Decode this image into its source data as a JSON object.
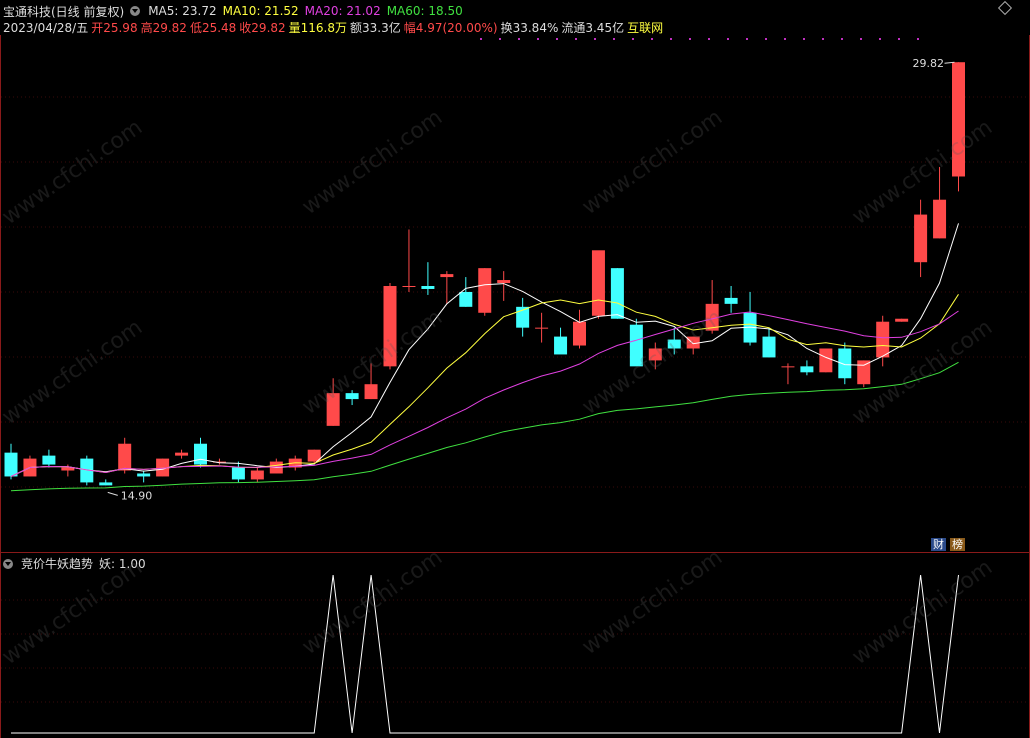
{
  "header": {
    "stock_name": "宝通科技(日线 前复权)",
    "ma5": "MA5: 23.72",
    "ma10": "MA10: 21.52",
    "ma20": "MA20: 21.02",
    "ma60": "MA60: 18.50"
  },
  "quote_bar": {
    "date": "2023/04/28/五",
    "open": "开25.98",
    "high": "高29.82",
    "low": "低25.48",
    "close": "收29.82",
    "volume": "量116.8万",
    "amount": "额33.3亿",
    "change": "幅4.97(20.00%)",
    "turnover": "换33.84%",
    "float": "流通3.45亿",
    "source": "互联网"
  },
  "chart_annotations": {
    "max_price": "29.82",
    "min_price": "14.90"
  },
  "tags": {
    "cai": "财",
    "bang": "榜"
  },
  "indicator": {
    "title": "竞价牛妖趋势",
    "value": "妖: 1.00"
  },
  "watermark": "www.cfchi.com",
  "colors": {
    "up": "#ff4a4a",
    "down": "#40ffff",
    "ma5": "#ffffff",
    "ma10": "#ffff40",
    "ma20": "#e040e0",
    "ma60": "#40e040",
    "header_ma5": "#dddddd",
    "header_ma10": "#ffff40",
    "header_ma20": "#e040e0",
    "header_ma60": "#40e040"
  },
  "chart_data": {
    "type": "candlestick",
    "ylim": [
      14.0,
      30.6
    ],
    "candles": [
      {
        "o": 16.7,
        "h": 17.0,
        "l": 15.8,
        "c": 15.9
      },
      {
        "o": 15.9,
        "h": 16.6,
        "l": 15.9,
        "c": 16.5
      },
      {
        "o": 16.6,
        "h": 16.8,
        "l": 16.2,
        "c": 16.3
      },
      {
        "o": 16.1,
        "h": 16.3,
        "l": 15.9,
        "c": 16.2
      },
      {
        "o": 16.5,
        "h": 16.6,
        "l": 15.6,
        "c": 15.7
      },
      {
        "o": 15.7,
        "h": 15.8,
        "l": 15.6,
        "c": 15.6
      },
      {
        "o": 16.1,
        "h": 17.2,
        "l": 16.0,
        "c": 17.0
      },
      {
        "o": 16.0,
        "h": 16.1,
        "l": 15.7,
        "c": 15.9
      },
      {
        "o": 15.9,
        "h": 16.5,
        "l": 15.9,
        "c": 16.5
      },
      {
        "o": 16.6,
        "h": 16.8,
        "l": 16.5,
        "c": 16.7
      },
      {
        "o": 17.0,
        "h": 17.2,
        "l": 16.2,
        "c": 16.3
      },
      {
        "o": 16.4,
        "h": 16.5,
        "l": 16.3,
        "c": 16.4
      },
      {
        "o": 16.2,
        "h": 16.4,
        "l": 15.7,
        "c": 15.8
      },
      {
        "o": 15.8,
        "h": 16.2,
        "l": 15.7,
        "c": 16.1
      },
      {
        "o": 16.0,
        "h": 16.5,
        "l": 16.0,
        "c": 16.4
      },
      {
        "o": 16.2,
        "h": 16.6,
        "l": 16.1,
        "c": 16.5
      },
      {
        "o": 16.4,
        "h": 16.8,
        "l": 16.3,
        "c": 16.8
      },
      {
        "o": 17.6,
        "h": 19.2,
        "l": 17.6,
        "c": 18.7
      },
      {
        "o": 18.7,
        "h": 18.8,
        "l": 18.3,
        "c": 18.5
      },
      {
        "o": 18.5,
        "h": 19.7,
        "l": 18.5,
        "c": 19.0
      },
      {
        "o": 19.6,
        "h": 22.4,
        "l": 19.5,
        "c": 22.3
      },
      {
        "o": 22.3,
        "h": 24.2,
        "l": 22.1,
        "c": 22.3
      },
      {
        "o": 22.3,
        "h": 23.1,
        "l": 22.0,
        "c": 22.2
      },
      {
        "o": 22.6,
        "h": 22.8,
        "l": 21.7,
        "c": 22.7
      },
      {
        "o": 22.1,
        "h": 22.6,
        "l": 21.6,
        "c": 21.6
      },
      {
        "o": 21.4,
        "h": 22.9,
        "l": 21.3,
        "c": 22.9
      },
      {
        "o": 22.4,
        "h": 22.8,
        "l": 21.8,
        "c": 22.5
      },
      {
        "o": 21.6,
        "h": 21.9,
        "l": 20.6,
        "c": 20.9
      },
      {
        "o": 20.9,
        "h": 21.4,
        "l": 20.4,
        "c": 20.9
      },
      {
        "o": 20.6,
        "h": 20.9,
        "l": 20.1,
        "c": 20.0
      },
      {
        "o": 20.3,
        "h": 21.5,
        "l": 20.2,
        "c": 21.1
      },
      {
        "o": 21.3,
        "h": 23.4,
        "l": 21.2,
        "c": 23.5
      },
      {
        "o": 22.9,
        "h": 22.9,
        "l": 21.2,
        "c": 21.2
      },
      {
        "o": 21.0,
        "h": 21.2,
        "l": 19.7,
        "c": 19.6
      },
      {
        "o": 19.8,
        "h": 20.4,
        "l": 19.5,
        "c": 20.2
      },
      {
        "o": 20.5,
        "h": 20.9,
        "l": 20.0,
        "c": 20.2
      },
      {
        "o": 20.2,
        "h": 20.6,
        "l": 20.0,
        "c": 20.6
      },
      {
        "o": 20.8,
        "h": 22.5,
        "l": 20.7,
        "c": 21.7
      },
      {
        "o": 21.9,
        "h": 22.3,
        "l": 21.4,
        "c": 21.7
      },
      {
        "o": 21.4,
        "h": 22.1,
        "l": 20.3,
        "c": 20.4
      },
      {
        "o": 20.6,
        "h": 20.9,
        "l": 19.9,
        "c": 19.9
      },
      {
        "o": 19.6,
        "h": 19.7,
        "l": 19.0,
        "c": 19.6
      },
      {
        "o": 19.6,
        "h": 19.8,
        "l": 19.3,
        "c": 19.4
      },
      {
        "o": 19.4,
        "h": 20.2,
        "l": 19.4,
        "c": 20.2
      },
      {
        "o": 20.2,
        "h": 20.4,
        "l": 19.0,
        "c": 19.2
      },
      {
        "o": 19.0,
        "h": 19.8,
        "l": 18.9,
        "c": 19.8
      },
      {
        "o": 19.9,
        "h": 21.3,
        "l": 19.6,
        "c": 21.1
      },
      {
        "o": 21.1,
        "h": 21.2,
        "l": 21.1,
        "c": 21.2
      },
      {
        "o": 23.1,
        "h": 25.2,
        "l": 22.6,
        "c": 24.7
      },
      {
        "o": 23.9,
        "h": 26.3,
        "l": 23.9,
        "c": 25.2
      },
      {
        "o": 25.98,
        "h": 29.82,
        "l": 25.48,
        "c": 29.82
      }
    ],
    "indicator": [
      0,
      0,
      0,
      0,
      0,
      0,
      0,
      0,
      0,
      0,
      0,
      0,
      0,
      0,
      0,
      0,
      0,
      1,
      0,
      1,
      0,
      0,
      0,
      0,
      0,
      0,
      0,
      0,
      0,
      0,
      0,
      0,
      0,
      0,
      0,
      0,
      0,
      0,
      0,
      0,
      0,
      0,
      0,
      0,
      0,
      0,
      0,
      0,
      1,
      0,
      1
    ]
  }
}
